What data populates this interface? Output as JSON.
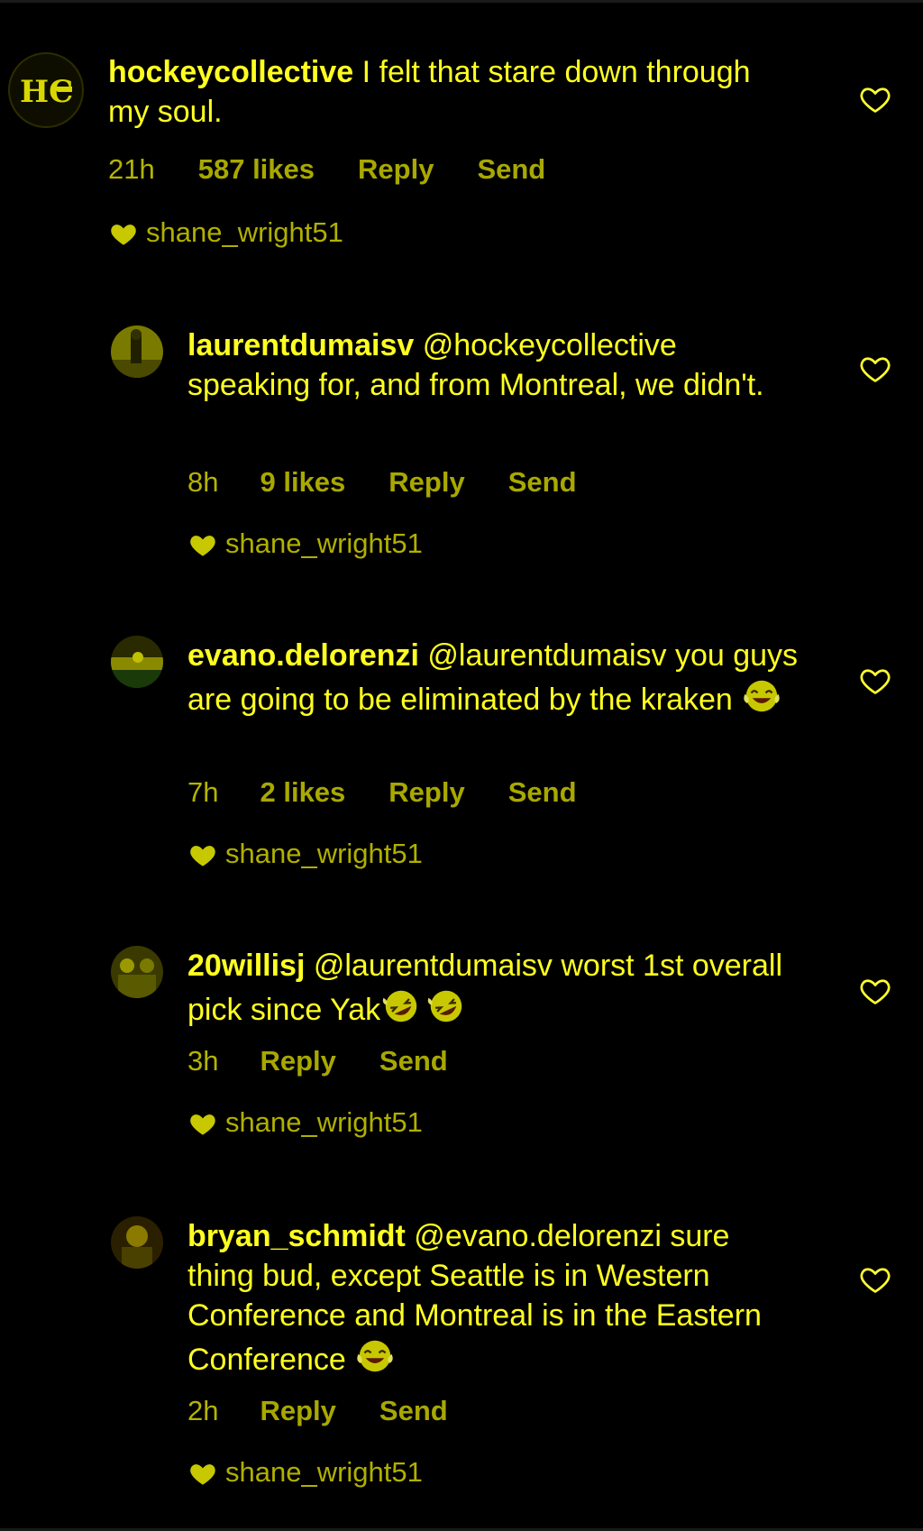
{
  "comments": [
    {
      "username": "hockeycollective",
      "text": " I felt that stare down through my soul.",
      "time": "21h",
      "likes": "587 likes",
      "reply": "Reply",
      "send": "Send",
      "liked_by": "shane_wright51",
      "avatar_icon": "hc-logo-icon"
    },
    {
      "username": "laurentdumaisv",
      "text": " @hockeycollective speaking for, and from Montreal, we didn't.",
      "time": "8h",
      "likes": "9 likes",
      "reply": "Reply",
      "send": "Send",
      "liked_by": "shane_wright51",
      "avatar_icon": "user-photo-icon"
    },
    {
      "username": "evano.delorenzi",
      "text": " @laurentdumaisv you guys are going to be eliminated by the kraken ",
      "emoji": "face-with-tears-of-joy",
      "time": "7h",
      "likes": "2 likes",
      "reply": "Reply",
      "send": "Send",
      "liked_by": "shane_wright51",
      "avatar_icon": "user-photo-icon"
    },
    {
      "username": "20willisj",
      "text": " @laurentdumaisv worst 1st overall pick since Yak",
      "emoji": "rolling-on-floor-laughing",
      "time": "3h",
      "reply": "Reply",
      "send": "Send",
      "liked_by": "shane_wright51",
      "avatar_icon": "user-photo-icon"
    },
    {
      "username": "bryan_schmidt",
      "text": " @evano.delorenzi sure thing bud, except Seattle is in Western Conference and Montreal is in the Eastern Conference ",
      "emoji": "face-with-tears-of-joy",
      "time": "2h",
      "reply": "Reply",
      "send": "Send",
      "liked_by": "shane_wright51",
      "avatar_icon": "user-photo-icon"
    }
  ],
  "colors": {
    "background": "#000000",
    "text": "#ffff20",
    "meta": "#a8a800",
    "heart": "#c8c800"
  }
}
